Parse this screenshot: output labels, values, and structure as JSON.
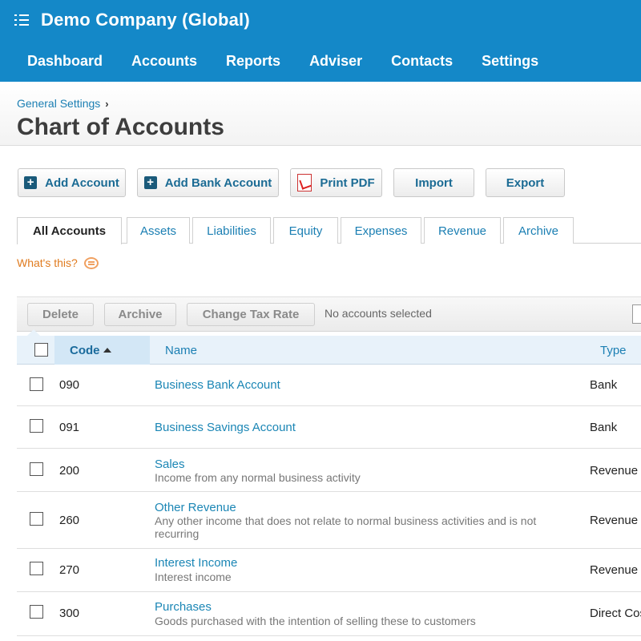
{
  "header": {
    "org_name": "Demo Company (Global)",
    "nav": [
      "Dashboard",
      "Accounts",
      "Reports",
      "Adviser",
      "Contacts",
      "Settings"
    ],
    "color": "#1488c8"
  },
  "breadcrumb": "General Settings",
  "page_title": "Chart of Accounts",
  "actions": {
    "add_account": "Add Account",
    "add_bank_account": "Add Bank Account",
    "print_pdf": "Print PDF",
    "import": "Import",
    "export": "Export"
  },
  "tabs": [
    "All Accounts",
    "Assets",
    "Liabilities",
    "Equity",
    "Expenses",
    "Revenue",
    "Archive"
  ],
  "active_tab": "All Accounts",
  "whats_this": "What's this?",
  "toolbar": {
    "delete": "Delete",
    "archive": "Archive",
    "change_tax_rate": "Change Tax Rate",
    "selection_status": "No accounts selected"
  },
  "table": {
    "columns": {
      "code": "Code",
      "name": "Name",
      "type": "Type"
    },
    "rows": [
      {
        "code": "090",
        "name": "Business Bank Account",
        "description": "",
        "type": "Bank"
      },
      {
        "code": "091",
        "name": "Business Savings Account",
        "description": "",
        "type": "Bank"
      },
      {
        "code": "200",
        "name": "Sales",
        "description": "Income from any normal business activity",
        "type": "Revenue"
      },
      {
        "code": "260",
        "name": "Other Revenue",
        "description": "Any other income that does not relate to normal business activities and is not recurring",
        "type": "Revenue"
      },
      {
        "code": "270",
        "name": "Interest Income",
        "description": "Interest income",
        "type": "Revenue"
      },
      {
        "code": "300",
        "name": "Purchases",
        "description": "Goods purchased with the intention of selling these to customers",
        "type": "Direct Cos"
      }
    ]
  }
}
